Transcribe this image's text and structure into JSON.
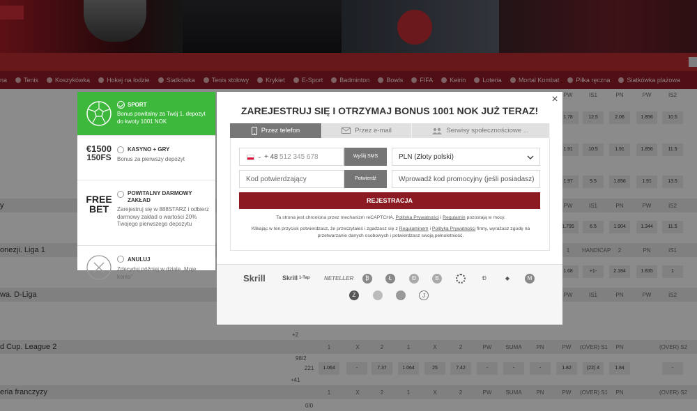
{
  "colors": {
    "accent": "#8b1a22",
    "sport_green": "#3db83d",
    "tab_active": "#777777"
  },
  "sports_nav": [
    {
      "label": "na",
      "icon": "tennis-icon"
    },
    {
      "label": "Tenis",
      "icon": "tennis-icon"
    },
    {
      "label": "Koszykówka",
      "icon": "basketball-icon"
    },
    {
      "label": "Hokej na lodzie",
      "icon": "hockey-icon"
    },
    {
      "label": "Siatkówka",
      "icon": "volleyball-icon"
    },
    {
      "label": "Tenis stołowy",
      "icon": "table-tennis-icon"
    },
    {
      "label": "Krykiet",
      "icon": "cricket-icon"
    },
    {
      "label": "E-Sport",
      "icon": "gamepad-icon"
    },
    {
      "label": "Badminton",
      "icon": "badminton-icon"
    },
    {
      "label": "Bowls",
      "icon": "bowls-icon"
    },
    {
      "label": "FIFA",
      "icon": "fifa-icon"
    },
    {
      "label": "Keirin",
      "icon": "cycling-icon"
    },
    {
      "label": "Loteria",
      "icon": "lottery-icon"
    },
    {
      "label": "Mortal Kombat",
      "icon": "gamepad-icon"
    },
    {
      "label": "Piłka ręczna",
      "icon": "handball-icon"
    },
    {
      "label": "Siatkówka plażowa",
      "icon": "beach-volleyball-icon"
    }
  ],
  "background": {
    "leagues": [
      "y",
      "onezji. Liga 1",
      "wa. D-Liga",
      "d Cup. League 2",
      "eria franczyzy"
    ],
    "headers_a": [
      "PW",
      "IS1",
      "PN",
      "PW",
      "IS2"
    ],
    "headers_b": [
      "1",
      "HANDICAP",
      "2",
      "PN",
      "IS1"
    ],
    "headers_c": [
      "1",
      "X",
      "2",
      "PW",
      "SUMA",
      "PN",
      "(OVER) S1",
      "(OVER) S2"
    ],
    "row_vals_1": [
      "1.78",
      "12.5",
      "2.06",
      "1.856",
      "10.5"
    ],
    "row_vals_2": [
      "1.91",
      "10.5",
      "1.91",
      "1.856",
      "11.5"
    ],
    "row_vals_3": [
      "1.97",
      "9.5",
      "1.856",
      "1.91",
      "13.5"
    ],
    "row_vals_4": [
      "1.795",
      "6.5",
      "1.904",
      "1.344",
      "11.5"
    ],
    "row_vals_5": [
      "1.68",
      "+1-",
      "2.184",
      "1.835",
      "1"
    ],
    "row_vals_6": [
      "1.064",
      "-",
      "7.37",
      "1.064",
      "25",
      "7.42",
      "-",
      "-",
      "-",
      "1.82",
      "(22) 4",
      "1.84",
      "-"
    ],
    "misc": [
      "+2",
      "98/2",
      "221",
      "+41",
      "0/0"
    ]
  },
  "side_options": {
    "sport": {
      "title": "SPORT",
      "desc": "Bonus powitalny za Twój 1. depozyt do kwoty 1001 NOK"
    },
    "casino": {
      "title": "KASYNO + GRY",
      "desc": "Bonus za pierwszy depozyt",
      "icon_line1": "€1500",
      "icon_line2": "150FS"
    },
    "freebet": {
      "title": "POWITALNY DARMOWY ZAKŁAD",
      "desc": "Zarejestruj się w 888STARZ i odbierz darmowy zakład o wartości 20% Twojego pierwszego depozytu",
      "icon_line1": "FREE",
      "icon_line2": "BET"
    },
    "cancel": {
      "title": "ANULUJ",
      "desc": "Zdecyduj później w dziale „Moje konto”"
    }
  },
  "modal": {
    "title": "ZAREJESTRUJ SIĘ I OTRZYMAJ BONUS 1001 NOK JUŻ TERAZ!",
    "tabs": {
      "phone": "Przez telefon",
      "email": "Przez e-mail",
      "social": "Serwisy społecznościowe ..."
    },
    "phone_prefix": "+ 48",
    "phone_placeholder": "512 345 678",
    "send_sms": "Wyślij SMS",
    "currency": "PLN (Złoty polski)",
    "code_placeholder": "Kod potwierdzający",
    "confirm": "Potwierdź",
    "promo_placeholder": "Wprowadź kod promocyjny (jeśli posiadasz)",
    "register": "REJESTRACJA",
    "recaptcha_pre": "Ta strona jest chroniona przez mechanizm reCAPTCHA, ",
    "privacy_link": "Polityka Prywatności",
    "and": " i ",
    "rules_link": "Regulamin",
    "recaptcha_post": " pozostają w mocy.",
    "consent_pre": "Klikając w ten przycisk potwierdzasz, że przeczytałeś i zgadzasz się z ",
    "consent_rules": "Regulaminem",
    "consent_mid": " i ",
    "consent_privacy": "Polityką Prywatności",
    "consent_post": " firmy, wyrażasz zgodę na przetwarzanie danych osobowych i potwierdzasz swoją pełnoletniość.",
    "close": "×"
  },
  "payments": {
    "skrill": "Skrill",
    "skrill1tap": "Skrill",
    "skrill1tap_sub": "1-Tap",
    "neteller": "NETELLER"
  }
}
